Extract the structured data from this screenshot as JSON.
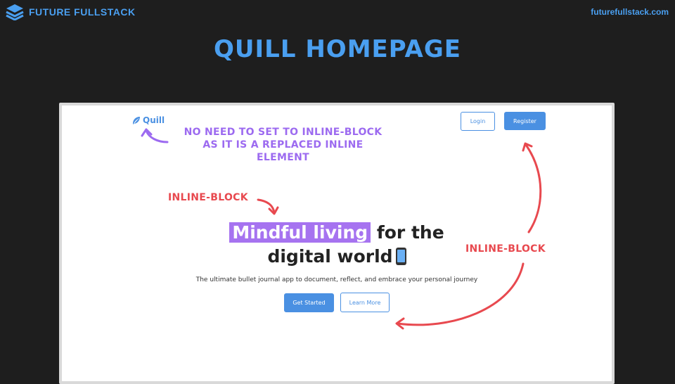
{
  "slide": {
    "brand_name": "FUTURE FULLSTACK",
    "site_url": "futurefullstack.com",
    "title": "QUILL HOMEPAGE"
  },
  "page": {
    "logo_text": "Quill",
    "login_label": "Login",
    "register_label": "Register",
    "hero_highlight": "Mindful living",
    "hero_rest_line1": "for the",
    "hero_line2": "digital world",
    "subtitle": "The ultimate bullet journal app to document, reflect, and embrace your personal journey",
    "get_started_label": "Get Started",
    "learn_more_label": "Learn More"
  },
  "annotations": {
    "replaced_element_note": "NO NEED TO SET TO INLINE-BLOCK AS IT IS A REPLACED INLINE ELEMENT",
    "inline_block_hero": "INLINE-BLOCK",
    "inline_block_buttons": "INLINE-BLOCK"
  },
  "colors": {
    "slide_background": "#1e1e1e",
    "brand_blue": "#4a9ff0",
    "button_blue": "#4a90e2",
    "highlight_purple": "#a673f0",
    "annotation_purple": "#9c6af0",
    "annotation_red": "#e8494f"
  },
  "icons": {
    "brand": "layers-stack-icon",
    "quill_logo": "feather-icon",
    "hero_emoji": "mobile-phone-icon"
  }
}
